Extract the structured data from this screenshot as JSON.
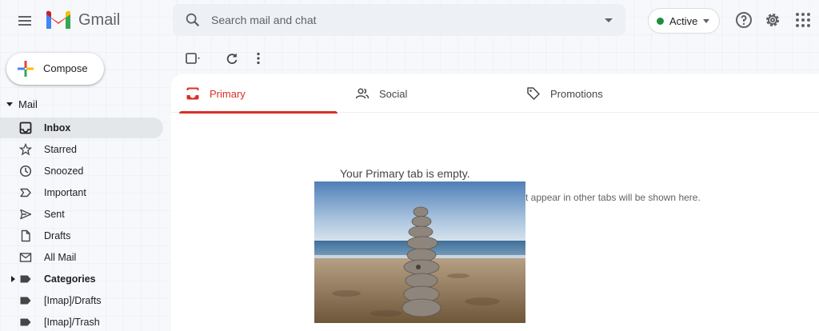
{
  "header": {
    "brand": "Gmail",
    "menu_icon": "hamburger-menu-icon",
    "search": {
      "placeholder": "Search mail and chat",
      "value": "",
      "icon": "search-icon"
    },
    "status": {
      "label": "Active",
      "color": "#1e8e3e"
    },
    "icons": [
      "help-icon",
      "settings-gear-icon",
      "apps-grid-icon"
    ]
  },
  "sidebar": {
    "compose_label": "Compose",
    "section_label": "Mail",
    "items": [
      {
        "label": "Inbox",
        "icon": "inbox-icon",
        "selected": true
      },
      {
        "label": "Starred",
        "icon": "star-icon"
      },
      {
        "label": "Snoozed",
        "icon": "clock-icon"
      },
      {
        "label": "Important",
        "icon": "important-icon"
      },
      {
        "label": "Sent",
        "icon": "send-icon"
      },
      {
        "label": "Drafts",
        "icon": "draft-icon"
      },
      {
        "label": "All Mail",
        "icon": "mail-icon"
      },
      {
        "label": "Categories",
        "icon": "label-icon",
        "expandable": true
      },
      {
        "label": "[Imap]/Drafts",
        "icon": "label-icon"
      },
      {
        "label": "[Imap]/Trash",
        "icon": "label-icon"
      }
    ]
  },
  "toolbar": {
    "icons": [
      "select-checkbox-icon",
      "refresh-icon",
      "more-vert-icon"
    ]
  },
  "tabs": [
    {
      "label": "Primary",
      "icon": "inbox-tab-icon",
      "active": true
    },
    {
      "label": "Social",
      "icon": "people-icon"
    },
    {
      "label": "Promotions",
      "icon": "tag-icon"
    }
  ],
  "main": {
    "empty_title": "Your Primary tab is empty.",
    "empty_subtitle": "t appear in other tabs will be shown here."
  },
  "colors": {
    "accent": "#d93025",
    "selected_bg": "#e4e7ea"
  }
}
